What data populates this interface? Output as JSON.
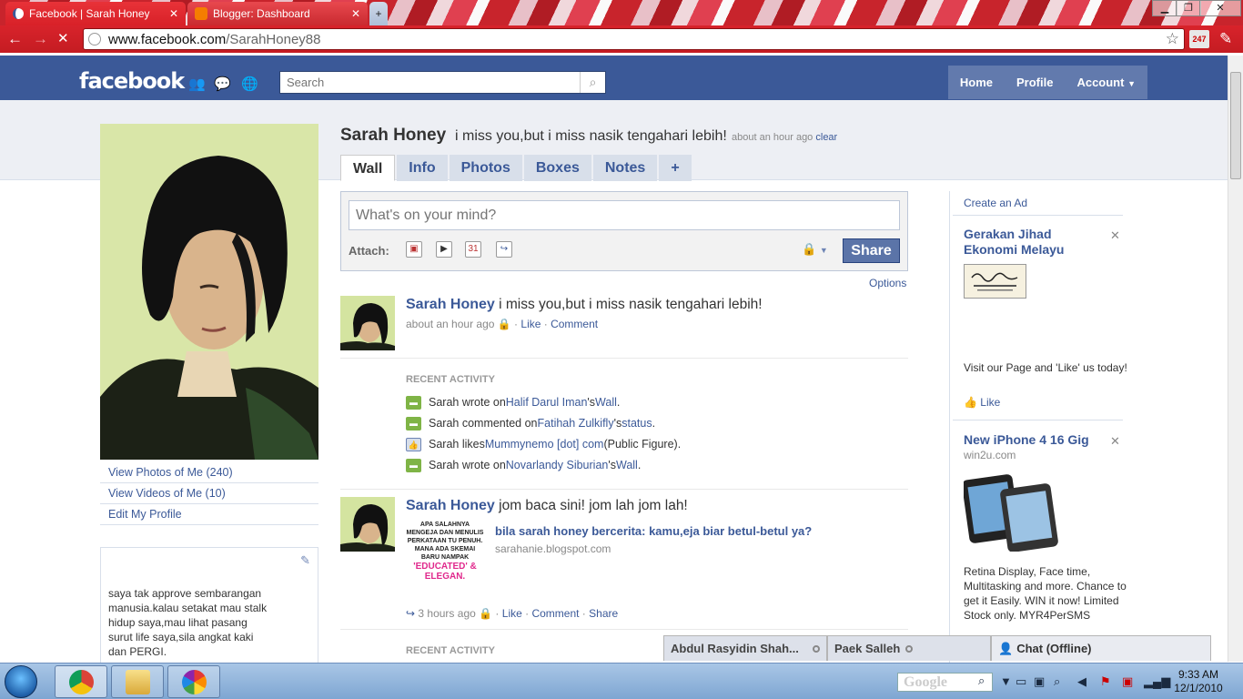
{
  "browser": {
    "tabs": [
      {
        "title": "Facebook | Sarah Honey",
        "active": true
      },
      {
        "title": "Blogger: Dashboard",
        "active": false
      }
    ],
    "url_host": "www.facebook.com",
    "url_path": "/SarahHoney88"
  },
  "fb_header": {
    "logo": "facebook",
    "search_placeholder": "Search",
    "nav": [
      "Home",
      "Profile",
      "Account"
    ]
  },
  "profile": {
    "name": "Sarah Honey",
    "status": "i miss you,but i miss nasik tengahari lebih!",
    "status_time": "about an hour ago",
    "clear_label": "clear",
    "tabs": [
      "Wall",
      "Info",
      "Photos",
      "Boxes",
      "Notes",
      "+"
    ],
    "left_links": [
      "View Photos of Me (240)",
      "View Videos of Me (10)",
      "Edit My Profile"
    ],
    "bio": "saya tak approve sembarangan\nmanusia.kalau setakat mau stalk\nhidup saya,mau lihat pasang\nsurut life saya,sila angkat kaki\ndan PERGI.\n\nya saya sangat koya dan"
  },
  "composer": {
    "placeholder": "What's on your mind?",
    "attach_label": "Attach:",
    "share_label": "Share",
    "options_label": "Options",
    "calendar_day": "31"
  },
  "stories": [
    {
      "actor": "Sarah Honey",
      "text": "i miss you,but i miss nasik tengahari lebih!",
      "time": "about an hour ago",
      "actions": [
        "Like",
        "Comment"
      ]
    },
    {
      "actor": "Sarah Honey",
      "text": "jom baca sini! jom lah jom lah!",
      "time": "3 hours ago",
      "actions": [
        "Like",
        "Comment",
        "Share"
      ],
      "shared_title": "bila sarah honey bercerita: kamu,eja biar betul-betul ya?",
      "shared_domain": "sarahanie.blogspot.com",
      "thumb_text": "APA SALAHNYA MENGEJA DAN MENULIS PERKATAAN TU PENUH. MANA ADA SKEMAI BARU NAMPAK",
      "thumb_pink": "'EDUCATED' & ELEGAN."
    }
  ],
  "recent_activity": {
    "title": "RECENT ACTIVITY",
    "items": [
      {
        "pre": "Sarah wrote on ",
        "link1": "Halif Darul Iman",
        "mid": "'s ",
        "link2": "Wall",
        "post": ".",
        "icon": "wall"
      },
      {
        "pre": "Sarah commented on ",
        "link1": "Fatihah Zulkifly",
        "mid": "'s ",
        "link2": "status",
        "post": ".",
        "icon": "wall"
      },
      {
        "pre": "Sarah likes ",
        "link1": "Mummynemo [dot] com",
        "mid": " (Public Figure).",
        "link2": "",
        "post": "",
        "icon": "like"
      },
      {
        "pre": "Sarah wrote on ",
        "link1": "Novarlandy Siburian",
        "mid": "'s ",
        "link2": "Wall",
        "post": ".",
        "icon": "wall"
      }
    ]
  },
  "ads": {
    "create_ad": "Create an Ad",
    "ad1": {
      "title": "Gerakan Jihad Ekonomi Melayu",
      "body": "Visit our Page and 'Like' us today!",
      "like": "Like"
    },
    "ad2": {
      "title": "New iPhone 4 16 Gig",
      "domain": "win2u.com",
      "body": "Retina Display, Face time, Multitasking and more. Chance to get it Easily. WIN it now! Limited Stock only. MYR4PerSMS"
    }
  },
  "chat": {
    "tabs": [
      "Abdul Rasyidin Shah...",
      "Paek Salleh"
    ],
    "main": "Chat (Offline)"
  },
  "taskbar": {
    "search_text": "Google",
    "time": "9:33 AM",
    "date": "12/1/2010"
  },
  "colors": {
    "fb_blue": "#3b5998",
    "chrome_red": "#d8232b"
  }
}
